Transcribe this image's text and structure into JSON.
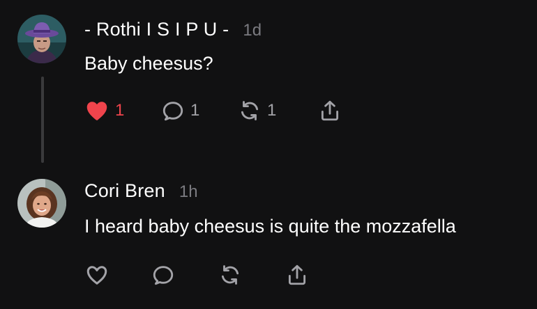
{
  "posts": [
    {
      "author": "- Rothi I S I P U -",
      "time": "1d",
      "text": "Baby cheesus?",
      "likes": "1",
      "replies": "1",
      "reposts": "1",
      "liked": true
    },
    {
      "author": "Cori Bren",
      "time": "1h",
      "text": "I heard baby cheesus is quite the mozzafella",
      "liked": false
    }
  ],
  "colors": {
    "background": "#111112",
    "like_active": "#f0444c",
    "muted_text": "#7b7b80",
    "icon": "#a3a3a8"
  },
  "icons": [
    "heart-icon",
    "comment-icon",
    "repost-icon",
    "share-icon"
  ]
}
